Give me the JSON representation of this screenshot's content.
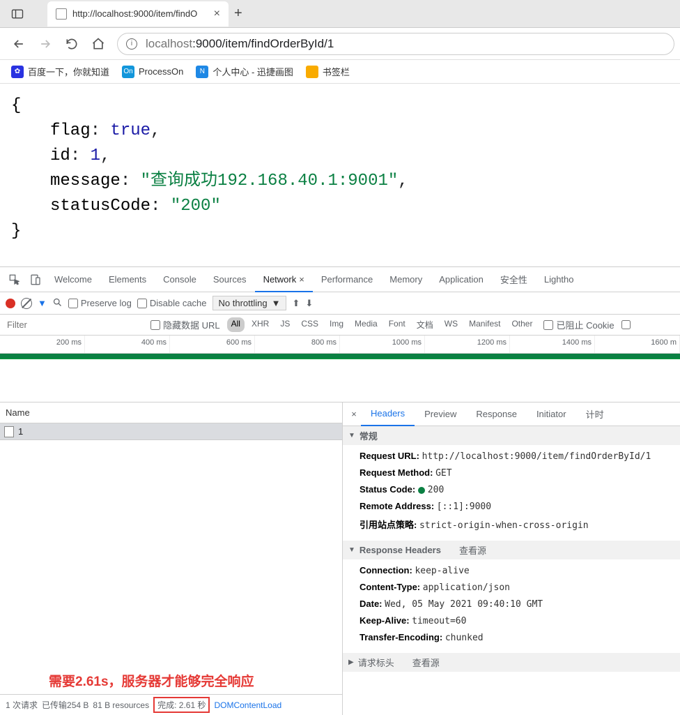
{
  "titleBar": {
    "tabTitle": "http://localhost:9000/item/findO"
  },
  "navBar": {
    "urlGrey1": "localhost",
    "urlBlack": ":9000/item/findOrderById/1"
  },
  "bookmarks": [
    {
      "label": "百度一下，你就知道",
      "color": "#2932e1",
      "ico": "paw"
    },
    {
      "label": "ProcessOn",
      "color": "#1296db",
      "ico": "On"
    },
    {
      "label": "个人中心 - 迅捷画图",
      "color": "#1e88e5",
      "ico": "N"
    },
    {
      "label": "书签栏",
      "color": "#f9ab00",
      "ico": "folder"
    }
  ],
  "json": {
    "flagKey": "flag",
    "flagVal": "true",
    "idKey": "id",
    "idVal": "1",
    "msgKey": "message",
    "msgVal": "\"查询成功192.168.40.1:9001\"",
    "scKey": "statusCode",
    "scVal": "\"200\""
  },
  "devtoolsTabs": [
    "Welcome",
    "Elements",
    "Console",
    "Sources",
    "Network",
    "Performance",
    "Memory",
    "Application",
    "安全性",
    "Lightho"
  ],
  "activeTab": "Network",
  "toolbar": {
    "preserve": "Preserve log",
    "disable": "Disable cache",
    "throttle": "No throttling"
  },
  "filterBar": {
    "placeholder": "Filter",
    "hideData": "隐藏数据 URL",
    "types": [
      "All",
      "XHR",
      "JS",
      "CSS",
      "Img",
      "Media",
      "Font",
      "文档",
      "WS",
      "Manifest",
      "Other"
    ],
    "blocked": "已阻止 Cookie"
  },
  "timeline": [
    "200 ms",
    "400 ms",
    "600 ms",
    "800 ms",
    "1000 ms",
    "1200 ms",
    "1400 ms",
    "1600 m"
  ],
  "reqList": {
    "header": "Name",
    "row": "1"
  },
  "annotation": "需要2.61s，服务器才能够完全响应",
  "reqFooter": {
    "reqs": "1 次请求",
    "xfer": "已传输254 B",
    "res": "81 B resources",
    "finish": "完成: 2.61 秒",
    "dom": "DOMContentLoad"
  },
  "detailTabs": [
    "Headers",
    "Preview",
    "Response",
    "Initiator",
    "计时"
  ],
  "headers": {
    "general": {
      "title": "常规",
      "items": [
        {
          "k": "Request URL:",
          "v": "http://localhost:9000/item/findOrderById/1"
        },
        {
          "k": "Request Method:",
          "v": "GET"
        },
        {
          "k": "Status Code:",
          "v": "200",
          "status": true
        },
        {
          "k": "Remote Address:",
          "v": "[::1]:9000"
        },
        {
          "k": "引用站点策略:",
          "v": "strict-origin-when-cross-origin"
        }
      ]
    },
    "response": {
      "title": "Response Headers",
      "viewSrc": "查看源",
      "items": [
        {
          "k": "Connection:",
          "v": "keep-alive"
        },
        {
          "k": "Content-Type:",
          "v": "application/json"
        },
        {
          "k": "Date:",
          "v": "Wed, 05 May 2021 09:40:10 GMT"
        },
        {
          "k": "Keep-Alive:",
          "v": "timeout=60"
        },
        {
          "k": "Transfer-Encoding:",
          "v": "chunked"
        }
      ]
    },
    "request": {
      "title": "请求标头",
      "viewSrc": "查看源"
    }
  }
}
